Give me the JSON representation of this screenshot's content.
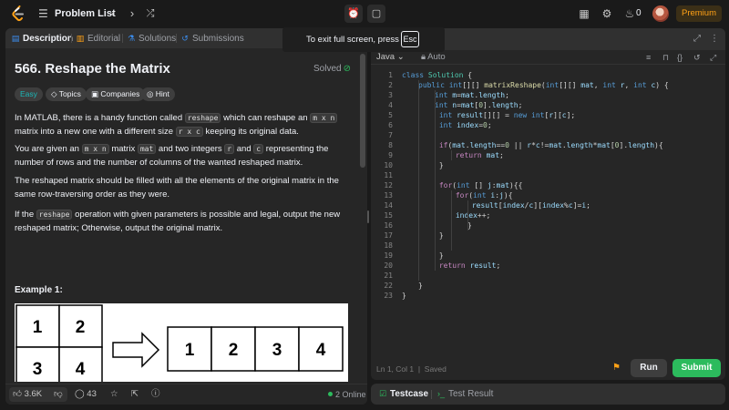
{
  "topbar": {
    "problem_list_label": "Problem List",
    "coins": "0",
    "premium_label": "Premium"
  },
  "tabs": [
    {
      "label": "Description",
      "icon": "document-icon"
    },
    {
      "label": "Editorial",
      "icon": "book-icon"
    },
    {
      "label": "Solutions",
      "icon": "flask-icon"
    },
    {
      "label": "Submissions",
      "icon": "history-icon"
    }
  ],
  "problem": {
    "title": "566. Reshape the Matrix",
    "status": "Solved",
    "difficulty": "Easy",
    "chips": [
      "Topics",
      "Companies",
      "Hint"
    ],
    "desc1": {
      "t1": "In MATLAB, there is a handy function called ",
      "c1": "reshape",
      "t2": " which can reshape an ",
      "c2": "m x n",
      "t3": " matrix into a new one with a different size ",
      "c3": "r x c",
      "t4": " keeping its original data."
    },
    "desc2": {
      "t1": "You are given an ",
      "c1": "m x n",
      "t2": " matrix ",
      "c2": "mat",
      "t3": " and two integers ",
      "c3": "r",
      "t4": " and ",
      "c4": "c",
      "t5": " representing the number of rows and the number of columns of the wanted reshaped matrix."
    },
    "desc3": "The reshaped matrix should be filled with all the elements of the original matrix in the same row-traversing order as they were.",
    "desc4": {
      "t1": "If the ",
      "c1": "reshape",
      "t2": " operation with given parameters is possible and legal, output the new reshaped matrix; Otherwise, output the original matrix."
    },
    "example_title": "Example 1:",
    "example_input": [
      "1",
      "2",
      "3",
      "4"
    ],
    "example_output": [
      "1",
      "2",
      "3",
      "4"
    ]
  },
  "bottombar": {
    "likes": "3.6K",
    "comments": "43",
    "online": "2 Online"
  },
  "editor": {
    "language": "Java",
    "mode": "Auto",
    "status": "Ln 1, Col 1",
    "saved": "Saved"
  },
  "code_lines": [
    {
      "n": "1",
      "indent": 0,
      "html": "<span class=\"kw\">class</span> <span class=\"ty\">Solution</span> <span class=\"op\">{</span>"
    },
    {
      "n": "2",
      "indent": 1,
      "html": "<span class=\"kw\">public</span> <span class=\"kw\">int</span><span class=\"op\">[][]</span> <span class=\"fn\">matrixReshape</span><span class=\"op\">(</span><span class=\"kw\">int</span><span class=\"op\">[][]</span> <span class=\"vr\">mat</span><span class=\"op\">,</span> <span class=\"kw\">int</span> <span class=\"vr\">r</span><span class=\"op\">,</span> <span class=\"kw\">int</span> <span class=\"vr\">c</span><span class=\"op\">) {</span>"
    },
    {
      "n": "3",
      "indent": 2,
      "html": "<span class=\"kw\">int</span> <span class=\"vr\">m</span><span class=\"op\">=</span><span class=\"vr\">mat</span><span class=\"op\">.</span><span class=\"vr\">length</span><span class=\"op\">;</span>"
    },
    {
      "n": "4",
      "indent": 2,
      "html": "<span class=\"kw\">int</span> <span class=\"vr\">n</span><span class=\"op\">=</span><span class=\"vr\">mat</span><span class=\"op\">[</span><span class=\"nm\">0</span><span class=\"op\">].</span><span class=\"vr\">length</span><span class=\"op\">;</span>"
    },
    {
      "n": "5",
      "indent": 2,
      "html": " <span class=\"kw\">int</span> <span class=\"vr\">result</span><span class=\"op\">[][] =</span> <span class=\"kw\">new</span> <span class=\"kw\">int</span><span class=\"op\">[</span><span class=\"vr\">r</span><span class=\"op\">][</span><span class=\"vr\">c</span><span class=\"op\">];</span>"
    },
    {
      "n": "6",
      "indent": 2,
      "html": " <span class=\"kw\">int</span> <span class=\"vr\">index</span><span class=\"op\">=</span><span class=\"nm\">0</span><span class=\"op\">;</span>"
    },
    {
      "n": "7",
      "indent": 0,
      "html": ""
    },
    {
      "n": "8",
      "indent": 2,
      "html": " <span class=\"kc\">if</span><span class=\"op\">(</span><span class=\"vr\">mat</span><span class=\"op\">.</span><span class=\"vr\">length</span><span class=\"op\">==</span><span class=\"nm\">0</span> <span class=\"op\">||</span> <span class=\"vr\">r</span><span class=\"op\">*</span><span class=\"vr\">c</span><span class=\"op\">!=</span><span class=\"vr\">mat</span><span class=\"op\">.</span><span class=\"vr\">length</span><span class=\"op\">*</span><span class=\"vr\">mat</span><span class=\"op\">[</span><span class=\"nm\">0</span><span class=\"op\">].</span><span class=\"vr\">length</span><span class=\"op\">){</span>"
    },
    {
      "n": "9",
      "indent": 3,
      "html": " <span class=\"kc\">return</span> <span class=\"vr\">mat</span><span class=\"op\">;</span>"
    },
    {
      "n": "10",
      "indent": 2,
      "html": " <span class=\"op\">}</span>"
    },
    {
      "n": "11",
      "indent": 0,
      "html": ""
    },
    {
      "n": "12",
      "indent": 2,
      "html": " <span class=\"kc\">for</span><span class=\"op\">(</span><span class=\"kw\">int</span> <span class=\"op\">[]</span> <span class=\"vr\">j</span><span class=\"op\">:</span><span class=\"vr\">mat</span><span class=\"op\">){{</span>"
    },
    {
      "n": "13",
      "indent": 3,
      "html": " <span class=\"kc\">for</span><span class=\"op\">(</span><span class=\"kw\">int</span> <span class=\"vr\">i</span><span class=\"op\">:</span><span class=\"vr\">j</span><span class=\"op\">){</span>"
    },
    {
      "n": "14",
      "indent": 4,
      "html": " <span class=\"vr\">result</span><span class=\"op\">[</span><span class=\"vr\">index</span><span class=\"op\">/</span><span class=\"vr\">c</span><span class=\"op\">][</span><span class=\"vr\">index</span><span class=\"op\">%</span><span class=\"vr\">c</span><span class=\"op\">]=</span><span class=\"vr\">i</span><span class=\"op\">;</span>"
    },
    {
      "n": "15",
      "indent": 3,
      "html": " <span class=\"vr\">index</span><span class=\"op\">++;</span>"
    },
    {
      "n": "16",
      "indent": 4,
      "html": "<span class=\"op\">}</span>"
    },
    {
      "n": "17",
      "indent": 2,
      "html": " <span class=\"op\">}</span>"
    },
    {
      "n": "18",
      "indent": 0,
      "html": ""
    },
    {
      "n": "19",
      "indent": 2,
      "html": " <span class=\"op\">}</span>"
    },
    {
      "n": "20",
      "indent": 2,
      "html": " <span class=\"kc\">return</span> <span class=\"vr\">result</span><span class=\"op\">;</span>"
    },
    {
      "n": "21",
      "indent": 0,
      "html": ""
    },
    {
      "n": "22",
      "indent": 1,
      "html": "<span class=\"op\">}</span>"
    },
    {
      "n": "23",
      "indent": 0,
      "html": "<span class=\"op\">}</span>"
    }
  ],
  "actions": {
    "run_label": "Run",
    "submit_label": "Submit"
  },
  "test_tabs": {
    "testcase": "Testcase",
    "result": "Test Result"
  },
  "overlay": {
    "message": "To exit full screen, press",
    "key": "Esc"
  },
  "colors": {
    "accent": "#ffa116",
    "success": "#2cbb5d",
    "easy": "#1cb8b8"
  }
}
